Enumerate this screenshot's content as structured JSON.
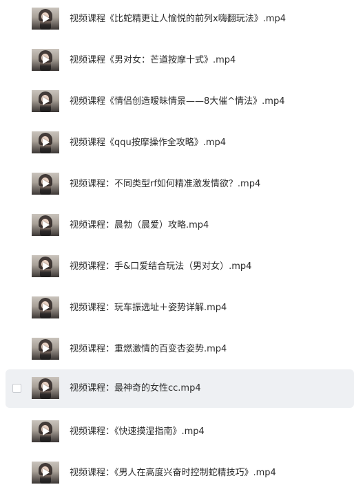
{
  "files": [
    {
      "name": "视频课程《比蛇精更让人愉悦的前列x嗨翻玩法》.mp4",
      "selected": false
    },
    {
      "name": "视频课程《男对女：芒道按摩十式》.mp4",
      "selected": false
    },
    {
      "name": "视频课程《情侣创造暧昧情景——8大催^情法》.mp4",
      "selected": false
    },
    {
      "name": "视频课程《qqu按摩操作全攻略》.mp4",
      "selected": false
    },
    {
      "name": "视频课程：不同类型rf如何精准激发情欲？.mp4",
      "selected": false
    },
    {
      "name": "视频课程：晨勃（晨爱）攻略.mp4",
      "selected": false
    },
    {
      "name": "视频课程：手&口爱结合玩法（男对女）.mp4",
      "selected": false
    },
    {
      "name": "视频课程：玩车振选址＋姿势详解.mp4",
      "selected": false
    },
    {
      "name": "视频课程：重燃激情的百变杏姿势.mp4",
      "selected": false
    },
    {
      "name": "视频课程：最神奇的女性cc.mp4",
      "selected": true
    },
    {
      "name": "视频课程：《快速摸湿指南》.mp4",
      "selected": false
    },
    {
      "name": "视频课程：《男人在高度兴奋时控制蛇精技巧》.mp4",
      "selected": false
    }
  ],
  "icons": {
    "thumbnail": "video-thumbnail-icon",
    "play": "play-icon",
    "checkbox": "checkbox-icon"
  },
  "colors": {
    "selected_row_bg": "#eef0f3",
    "text": "#2b2b2b"
  }
}
